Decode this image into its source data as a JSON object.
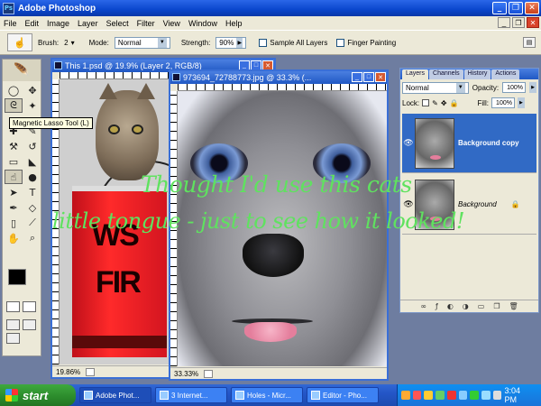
{
  "app": {
    "title": "Adobe Photoshop"
  },
  "menu": [
    "File",
    "Edit",
    "Image",
    "Layer",
    "Select",
    "Filter",
    "View",
    "Window",
    "Help"
  ],
  "options": {
    "brush_label": "Brush:",
    "brush_size": "2",
    "mode_label": "Mode:",
    "mode_value": "Normal",
    "strength_label": "Strength:",
    "strength_value": "90%",
    "sample_all_layers": "Sample All Layers",
    "finger_painting": "Finger Painting"
  },
  "tooltip": "Magnetic Lasso Tool (L)",
  "doc1": {
    "title": "This 1.psd @ 19.9% (Layer 2, RGB/8)",
    "zoom": "19.86%",
    "sign_top": "WS",
    "sign_bottom": "FIR"
  },
  "doc2": {
    "title": "973694_72788773.jpg @ 33.3% (...",
    "zoom": "33.33%"
  },
  "layers_panel": {
    "tabs": [
      "Layers",
      "Channels",
      "History",
      "Actions"
    ],
    "blend_mode": "Normal",
    "opacity_label": "Opacity:",
    "opacity_value": "100%",
    "lock_label": "Lock:",
    "fill_label": "Fill:",
    "fill_value": "100%",
    "layers": [
      {
        "name": "Background copy",
        "selected": true
      },
      {
        "name": "Background",
        "selected": false
      }
    ]
  },
  "overlay": {
    "line1": "Thought I'd use this cats",
    "line2": "little tongue - just to see how it looked!"
  },
  "taskbar": {
    "start": "start",
    "items": [
      "Adobe Phot...",
      "3 Internet...",
      "Holes - Micr...",
      "Editor - Pho..."
    ],
    "clock": "3:04 PM"
  }
}
